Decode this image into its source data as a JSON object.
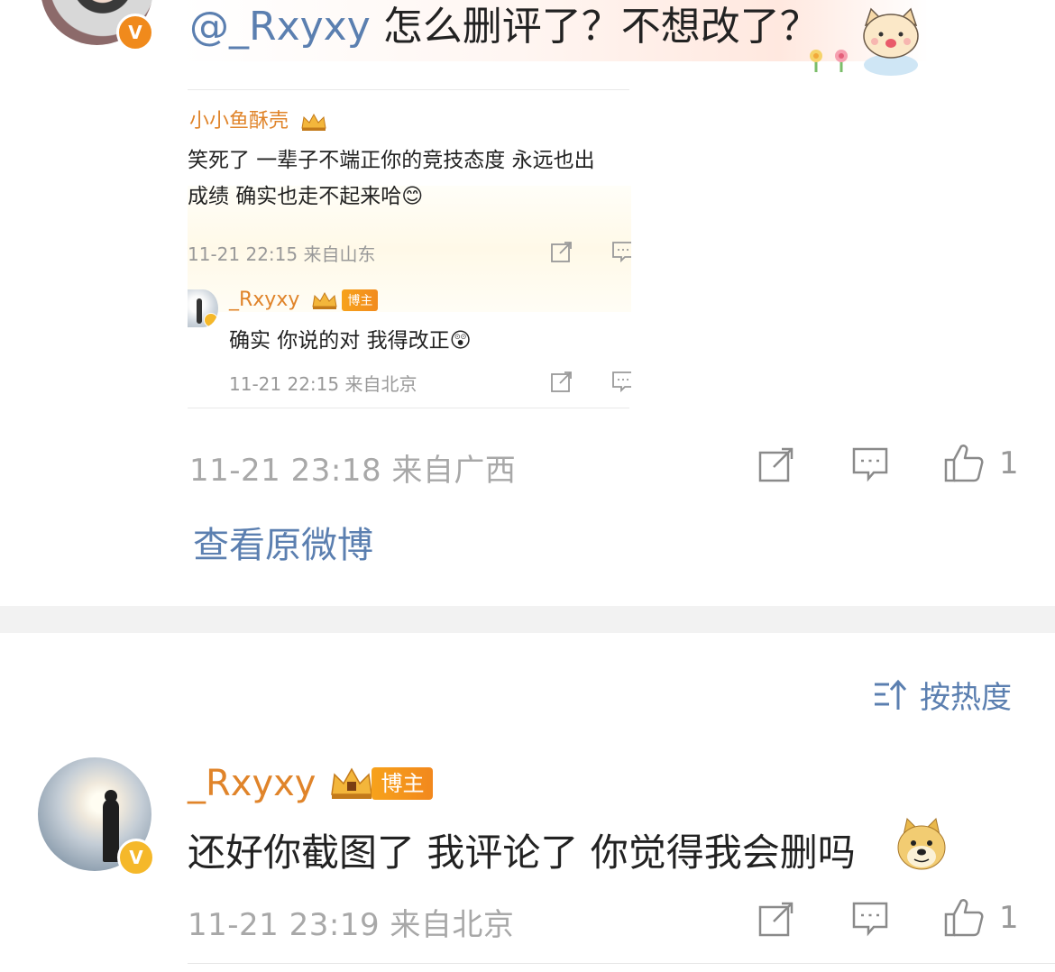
{
  "top_comment": {
    "mention": "@_Rxyxy",
    "text": " 怎么删评了？不想改了？",
    "badge": "V",
    "timestamp": "11-21 23:18",
    "location": "来自广西",
    "likes": "1",
    "view_original": "查看原微博"
  },
  "screenshot": {
    "commenter_name": "小小鱼酥壳",
    "comment_line1": "笑死了 一辈子不端正你的竞技态度 永远也出",
    "comment_line2": "成绩 确实也走不起来哈😊",
    "comment_meta": "11-21 22:15 来自山东",
    "reply_name": "_Rxyxy",
    "reply_tag": "博主",
    "reply_text": "确实 你说的对 我得改正😲",
    "reply_meta": "11-21 22:15 来自北京"
  },
  "sort": {
    "label": "按热度",
    "icon": "sort-hot-icon"
  },
  "second_comment": {
    "name": "_Rxyxy",
    "tag": "博主",
    "badge": "V",
    "text": "还好你截图了 我评论了 你觉得我会删吗",
    "timestamp": "11-21 23:19",
    "location": "来自北京",
    "likes": "1"
  },
  "colors": {
    "link_blue": "#5b7fb0",
    "name_orange": "#e0842a",
    "meta_gray": "#a8a8a8",
    "badge_orange": "#f08a1c",
    "badge_yellow": "#f5b82a"
  }
}
